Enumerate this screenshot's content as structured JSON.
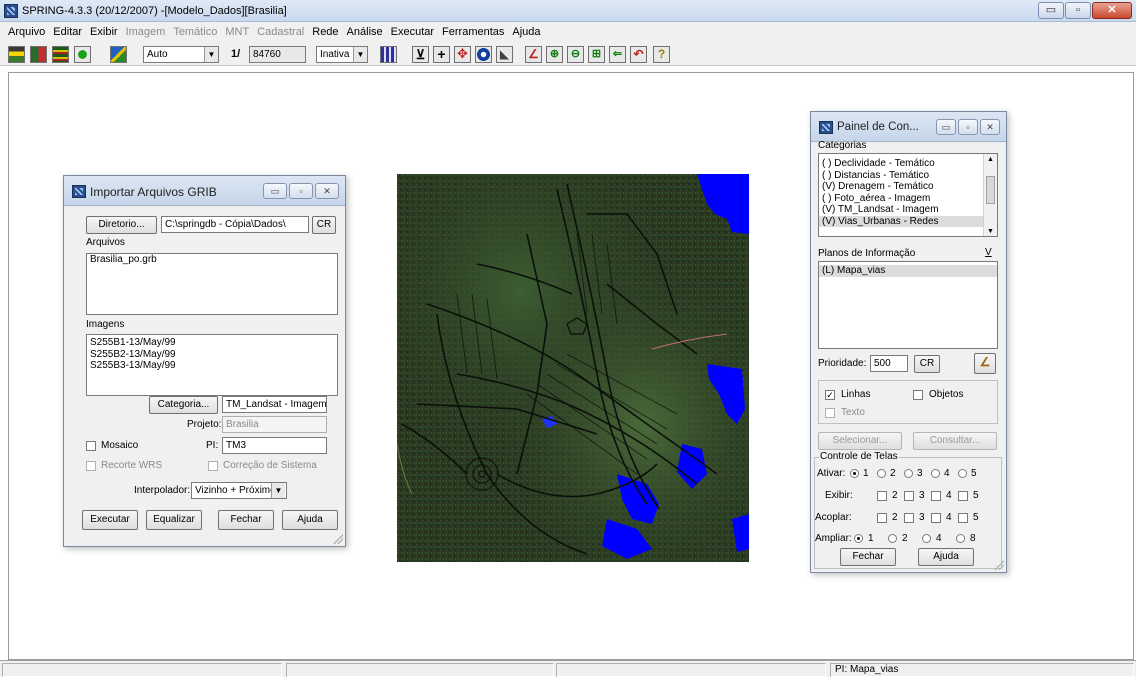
{
  "window": {
    "title": "SPRING-4.3.3 (20/12/2007) -[Modelo_Dados][Brasilia]",
    "buttons": [
      "▭",
      "▫",
      "✕"
    ]
  },
  "menu": {
    "items": [
      {
        "label": "Arquivo"
      },
      {
        "label": "Editar"
      },
      {
        "label": "Exibir"
      },
      {
        "label": "Imagem",
        "disabled": true
      },
      {
        "label": "Temático",
        "disabled": true
      },
      {
        "label": "MNT",
        "disabled": true
      },
      {
        "label": "Cadastral",
        "disabled": true
      },
      {
        "label": "Rede"
      },
      {
        "label": "Análise"
      },
      {
        "label": "Executar"
      },
      {
        "label": "Ferramentas"
      },
      {
        "label": "Ajuda"
      }
    ]
  },
  "toolbar": {
    "zoom_mode": "Auto",
    "scale_prefix": "1/",
    "scale_value": "84760",
    "state": "Inativa"
  },
  "status": {
    "pi": "PI: Mapa_vias"
  },
  "grib": {
    "title": "Importar Arquivos GRIB",
    "diretorio_label": "Diretorio...",
    "diretorio_value": "C:\\springdb - Cópia\\Dados\\",
    "cr_label": "CR",
    "arquivos_label": "Arquivos",
    "arquivos": [
      "Brasilia_po.grb"
    ],
    "imagens_label": "Imagens",
    "imagens": [
      "S255B1-13/May/99",
      "S255B2-13/May/99",
      "S255B3-13/May/99"
    ],
    "categoria_label": "Categoria...",
    "categoria_value": "TM_Landsat - Imagem",
    "projeto_label": "Projeto:",
    "projeto_value": "Brasilia",
    "mosaico_label": "Mosaico",
    "pi_label": "PI:",
    "pi_value": "TM3",
    "recorte_label": "Recorte WRS",
    "correcao_label": "Correção de Sistema",
    "interpolador_label": "Interpolador:",
    "interpolador_value": "Vizinho + Próximo",
    "executar": "Executar",
    "equalizar": "Equalizar",
    "fechar": "Fechar",
    "ajuda": "Ajuda"
  },
  "painel": {
    "title": "Painel de Con...",
    "categorias_label": "Categorias",
    "categorias": [
      "( ) Declividade - Temático",
      "( ) Distancias - Temático",
      "(V) Drenagem - Temático",
      "( ) Foto_aérea - Imagem",
      "(V) TM_Landsat - Imagem",
      "(V) Vias_Urbanas - Redes"
    ],
    "planos_label": "Planos de Informação",
    "planos_v": "V",
    "planos": [
      "(L) Mapa_vias"
    ],
    "prioridade_label": "Prioridade:",
    "prioridade_value": "500",
    "cr_label": "CR",
    "linhas_label": "Linhas",
    "objetos_label": "Objetos",
    "texto_label": "Texto",
    "selecionar": "Selecionar...",
    "consultar": "Consultar...",
    "controle_label": "Controle de Telas",
    "ativar_label": "Ativar:",
    "exibir_label": "Exibir:",
    "acoplar_label": "Acoplar:",
    "ampliar_label": "Ampliar:",
    "n1": "1",
    "n2": "2",
    "n3": "3",
    "n4": "4",
    "n5": "5",
    "n8": "8",
    "fechar": "Fechar",
    "ajuda": "Ajuda"
  },
  "colors": {
    "map_background": "#24331f",
    "water": "#0000ff",
    "roads": "#0a0f0a"
  }
}
